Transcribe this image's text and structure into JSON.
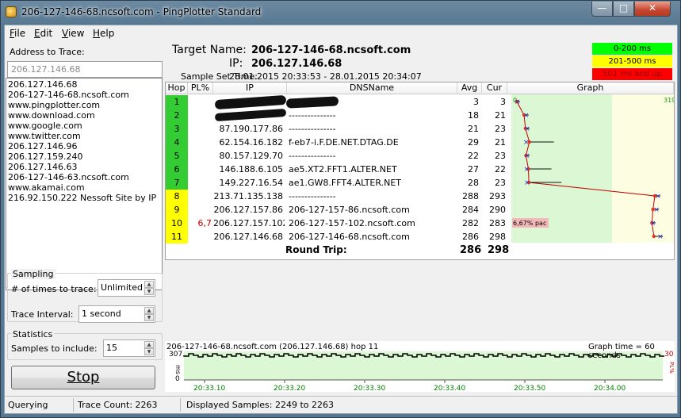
{
  "window": {
    "title": "206-127-146-68.ncsoft.com - PingPlotter Standard",
    "min": "—",
    "max": "□",
    "close": "✕"
  },
  "menu": [
    {
      "u": "F",
      "rest": "ile"
    },
    {
      "u": "E",
      "rest": "dit"
    },
    {
      "u": "V",
      "rest": "iew"
    },
    {
      "u": "H",
      "rest": "elp"
    }
  ],
  "left": {
    "address_label": "Address to Trace:",
    "address_value": "206.127.146.68",
    "history": [
      "206.127.146.68",
      "206-127-146-68.ncsoft.com",
      "www.pingplotter.com",
      "www.download.com",
      "www.google.com",
      "www.twitter.com",
      "206.127.146.96",
      "206.127.159.240",
      "206.127.146.63",
      "206-127-146-63.ncsoft.com",
      "www.akamai.com",
      "216.92.150.222 Nessoft Site by IP"
    ],
    "sampling": {
      "title": "Sampling",
      "times_label": "# of times to trace:",
      "times_value": "Unlimited",
      "interval_label": "Trace Interval:",
      "interval_value": "1 second"
    },
    "statistics": {
      "title": "Statistics",
      "samples_label": "Samples to include:",
      "samples_value": "15"
    },
    "stop_label": "Stop"
  },
  "header": {
    "target_label": "Target Name:",
    "target_value": "206-127-146-68.ncsoft.com",
    "ip_label": "IP:",
    "ip_value": "206.127.146.68",
    "sample_label": "Sample Set Time:",
    "sample_value": "28.01.2015 20:33:53 - 28.01.2015 20:34:07",
    "legend": [
      {
        "label": "0-200 ms",
        "color": "#00ff00",
        "text_color": "#000000"
      },
      {
        "label": "201-500 ms",
        "color": "#ffff00",
        "text_color": "#000000"
      },
      {
        "label": "501 ms and up",
        "color": "#ff0000",
        "text_color": "#8b0000"
      }
    ]
  },
  "table": {
    "columns": [
      "Hop",
      "PL%",
      "IP",
      "DNSName",
      "Avg",
      "Cur",
      "Graph"
    ],
    "graph_scale_start": "0",
    "graph_scale_end": "319",
    "rows": [
      {
        "hop": "1",
        "pl": "",
        "ip": "",
        "dns": "",
        "avg": "3",
        "cur": "3",
        "color": "#33cc33",
        "redacted": true
      },
      {
        "hop": "2",
        "pl": "",
        "ip": "",
        "dns": "---------------",
        "avg": "18",
        "cur": "21",
        "color": "#33cc33",
        "redacted": true
      },
      {
        "hop": "3",
        "pl": "",
        "ip": "87.190.177.86",
        "dns": "---------------",
        "avg": "21",
        "cur": "23",
        "color": "#33cc33"
      },
      {
        "hop": "4",
        "pl": "",
        "ip": "62.154.16.182",
        "dns": "f-eb7-i.F.DE.NET.DTAG.DE",
        "avg": "29",
        "cur": "21",
        "color": "#33cc33"
      },
      {
        "hop": "5",
        "pl": "",
        "ip": "80.157.129.70",
        "dns": "---------------",
        "avg": "22",
        "cur": "23",
        "color": "#33cc33"
      },
      {
        "hop": "6",
        "pl": "",
        "ip": "146.188.6.105",
        "dns": "ae5.XT2.FFT1.ALTER.NET",
        "avg": "27",
        "cur": "22",
        "color": "#33cc33"
      },
      {
        "hop": "7",
        "pl": "",
        "ip": "149.227.16.54",
        "dns": "ae1.GW8.FFT4.ALTER.NET",
        "avg": "28",
        "cur": "23",
        "color": "#33cc33"
      },
      {
        "hop": "8",
        "pl": "",
        "ip": "213.71.135.138",
        "dns": "---------------",
        "avg": "288",
        "cur": "293",
        "color": "#ffff00"
      },
      {
        "hop": "9",
        "pl": "",
        "ip": "206.127.157.86",
        "dns": "206-127-157-86.ncsoft.com",
        "avg": "284",
        "cur": "290",
        "color": "#ffff00"
      },
      {
        "hop": "10",
        "pl": "6,7",
        "ip": "206.127.157.102",
        "dns": "206-127-157-102.ncsoft.com",
        "avg": "282",
        "cur": "283",
        "color": "#ffff00",
        "loss_note": "6,67% pac"
      },
      {
        "hop": "11",
        "pl": "",
        "ip": "206.127.146.68",
        "dns": "206-127-146-68.ncsoft.com",
        "avg": "286",
        "cur": "298",
        "color": "#ffff00"
      }
    ],
    "round_trip_label": "Round Trip:",
    "round_trip_avg": "286",
    "round_trip_cur": "298"
  },
  "lower_chart": {
    "title": "206-127-146-68.ncsoft.com (206.127.146.68) hop 11",
    "graph_time": "Graph time = 60 seconds",
    "y_top": "307",
    "y_unit": "ms",
    "y_bottom": "0",
    "right_top": "30",
    "right_unit": "PL%",
    "x_labels": [
      "20:33.10",
      "20:33.20",
      "20:33.30",
      "20:33.40",
      "20:33.50",
      "20:34.00"
    ]
  },
  "status": {
    "state": "Querying",
    "trace_count": "Trace Count: 2263",
    "displayed": "Displayed Samples: 2249 to 2263"
  }
}
